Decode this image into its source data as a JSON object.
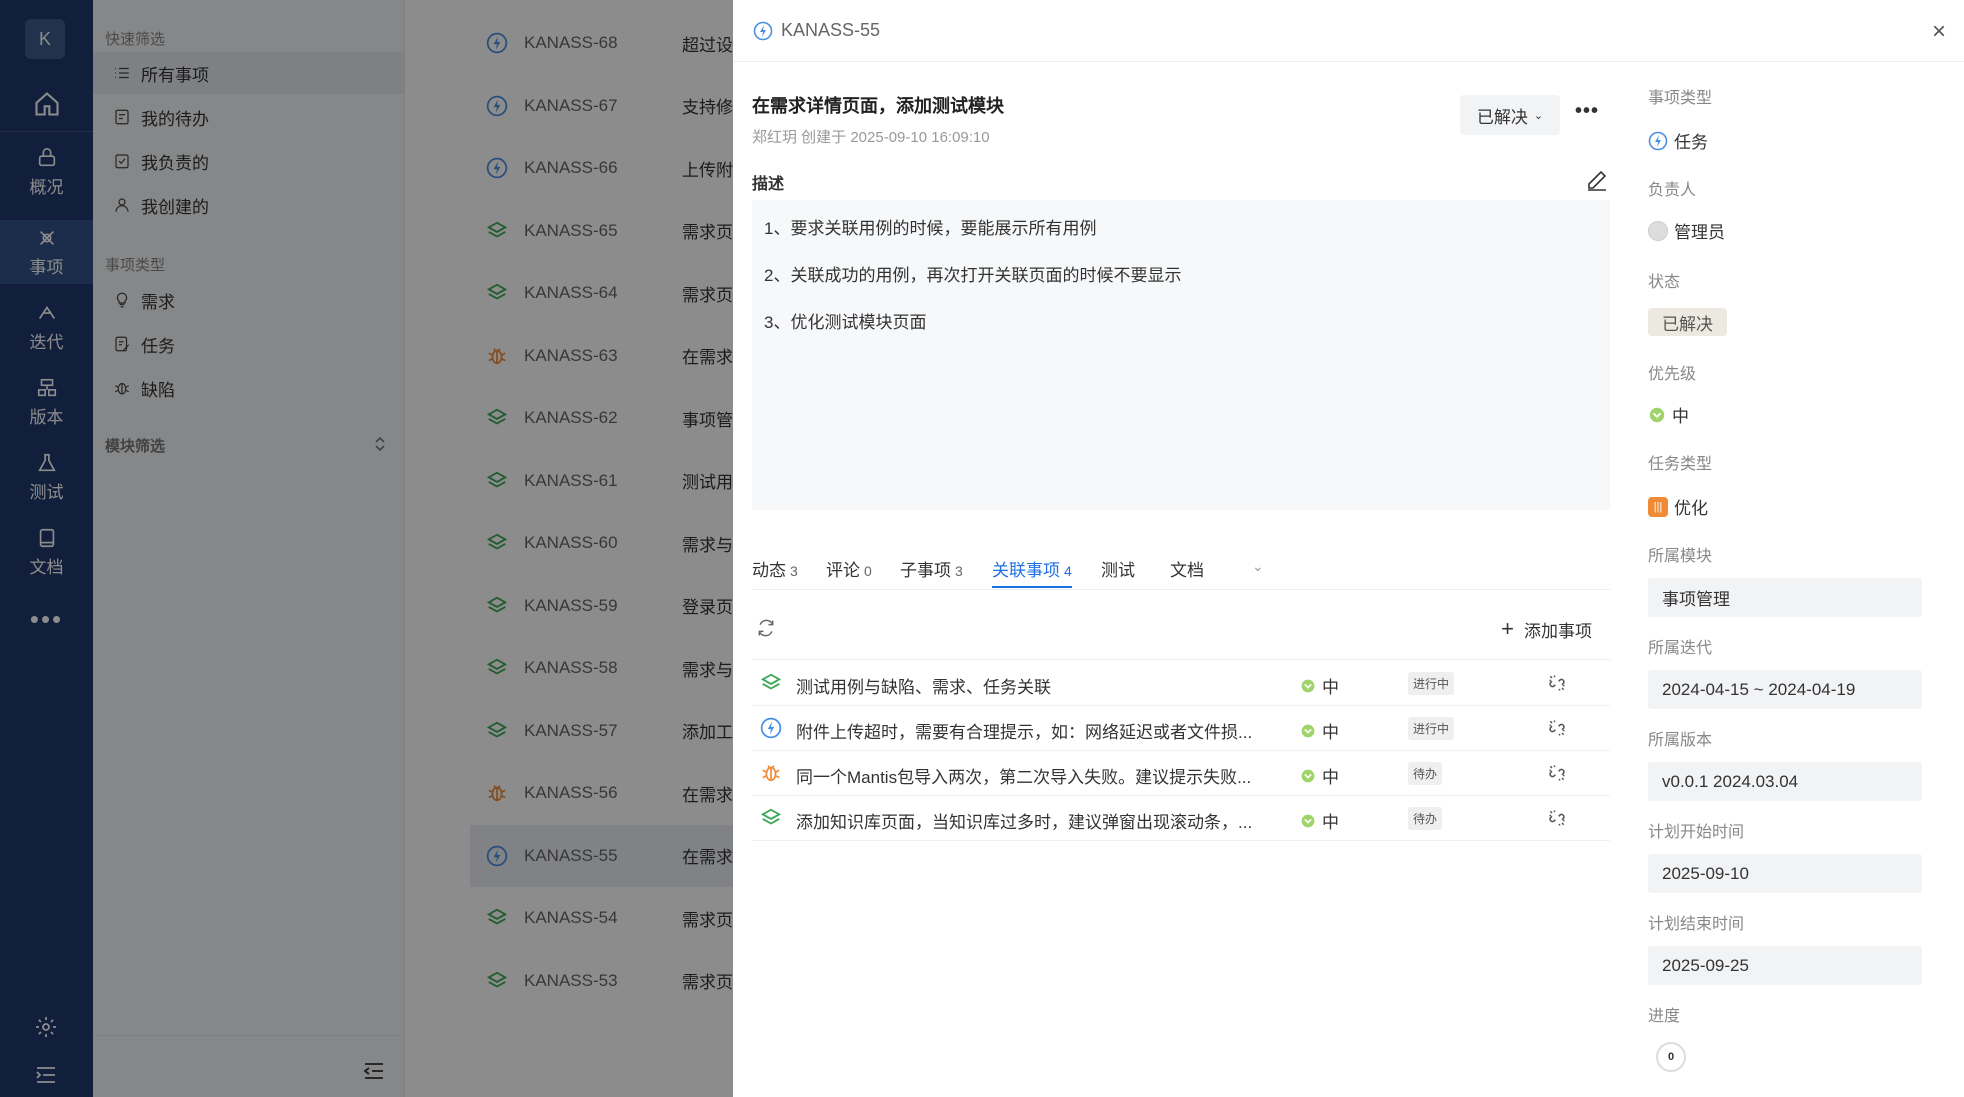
{
  "rail": {
    "avatar": "K",
    "items": [
      {
        "label": "概况"
      },
      {
        "label": "事项"
      },
      {
        "label": "迭代"
      },
      {
        "label": "版本"
      },
      {
        "label": "测试"
      },
      {
        "label": "文档"
      }
    ],
    "more": "•••"
  },
  "filters": {
    "quick_heading": "快速筛选",
    "quick": [
      "所有事项",
      "我的待办",
      "我负责的",
      "我创建的"
    ],
    "type_heading": "事项类型",
    "types": [
      "需求",
      "任务",
      "缺陷"
    ],
    "module_heading": "模块筛选"
  },
  "list": {
    "rows": [
      {
        "id": "KANASS-68",
        "title": "超过设",
        "icon": "task-icon"
      },
      {
        "id": "KANASS-67",
        "title": "支持修",
        "icon": "task-icon"
      },
      {
        "id": "KANASS-66",
        "title": "上传附",
        "icon": "task-icon"
      },
      {
        "id": "KANASS-65",
        "title": "需求页",
        "icon": "requirement-icon"
      },
      {
        "id": "KANASS-64",
        "title": "需求页",
        "icon": "requirement-icon"
      },
      {
        "id": "KANASS-63",
        "title": "在需求",
        "icon": "bug-icon"
      },
      {
        "id": "KANASS-62",
        "title": "事项管",
        "icon": "requirement-icon"
      },
      {
        "id": "KANASS-61",
        "title": "测试用",
        "icon": "requirement-icon"
      },
      {
        "id": "KANASS-60",
        "title": "需求与",
        "icon": "requirement-icon"
      },
      {
        "id": "KANASS-59",
        "title": "登录页",
        "icon": "requirement-icon"
      },
      {
        "id": "KANASS-58",
        "title": "需求与",
        "icon": "requirement-icon"
      },
      {
        "id": "KANASS-57",
        "title": "添加工",
        "icon": "requirement-icon"
      },
      {
        "id": "KANASS-56",
        "title": "在需求",
        "icon": "bug-icon"
      },
      {
        "id": "KANASS-55",
        "title": "在需求",
        "icon": "task-icon"
      },
      {
        "id": "KANASS-54",
        "title": "需求页",
        "icon": "requirement-icon"
      },
      {
        "id": "KANASS-53",
        "title": "需求页",
        "icon": "requirement-icon"
      }
    ]
  },
  "drawer": {
    "key": "KANASS-55",
    "close": "×",
    "title": "在需求详情页面，添加测试模块",
    "meta": "郑红玥 创建于 2025-09-10 16:09:10",
    "status_button": "已解决",
    "desc_label": "描述",
    "desc_lines": [
      "1、要求关联用例的时候，要能展示所有用例",
      "2、关联成功的用例，再次打开关联页面的时候不要显示",
      "3、优化测试模块页面"
    ],
    "tabs": [
      {
        "label": "动态",
        "count": "3"
      },
      {
        "label": "评论",
        "count": "0"
      },
      {
        "label": "子事项",
        "count": "3"
      },
      {
        "label": "关联事项",
        "count": "4"
      },
      {
        "label": "测试",
        "count": ""
      },
      {
        "label": "文档",
        "count": ""
      }
    ],
    "add_item": "添加事项",
    "related": [
      {
        "title": "测试用例与缺陷、需求、任务关联",
        "priority": "中",
        "status": "进行中",
        "icon": "requirement-icon"
      },
      {
        "title": "附件上传超时，需要有合理提示，如：网络延迟或者文件损...",
        "priority": "中",
        "status": "进行中",
        "icon": "task-icon"
      },
      {
        "title": "同一个Mantis包导入两次，第二次导入失败。建议提示失败...",
        "priority": "中",
        "status": "待办",
        "icon": "bug-icon"
      },
      {
        "title": "添加知识库页面，当知识库过多时，建议弹窗出现滚动条，...",
        "priority": "中",
        "status": "待办",
        "icon": "requirement-icon"
      }
    ]
  },
  "props": {
    "type_label": "事项类型",
    "type_value": "任务",
    "owner_label": "负责人",
    "owner_value": "管理员",
    "status_label": "状态",
    "status_value": "已解决",
    "priority_label": "优先级",
    "priority_value": "中",
    "task_type_label": "任务类型",
    "task_type_value": "优化",
    "module_label": "所属模块",
    "module_value": "事项管理",
    "iteration_label": "所属迭代",
    "iteration_value": "2024-04-15 ~ 2024-04-19",
    "version_label": "所属版本",
    "version_value": "v0.0.1 2024.03.04",
    "plan_start_label": "计划开始时间",
    "plan_start_value": "2025-09-10",
    "plan_end_label": "计划结束时间",
    "plan_end_value": "2025-09-25",
    "progress_label": "进度",
    "progress_value": "0"
  },
  "colors": {
    "rail_bg": "#1f3a6e",
    "accent": "#1f6fe5",
    "task": "#4a90e2",
    "requirement": "#3aa856",
    "bug": "#f08a35"
  }
}
